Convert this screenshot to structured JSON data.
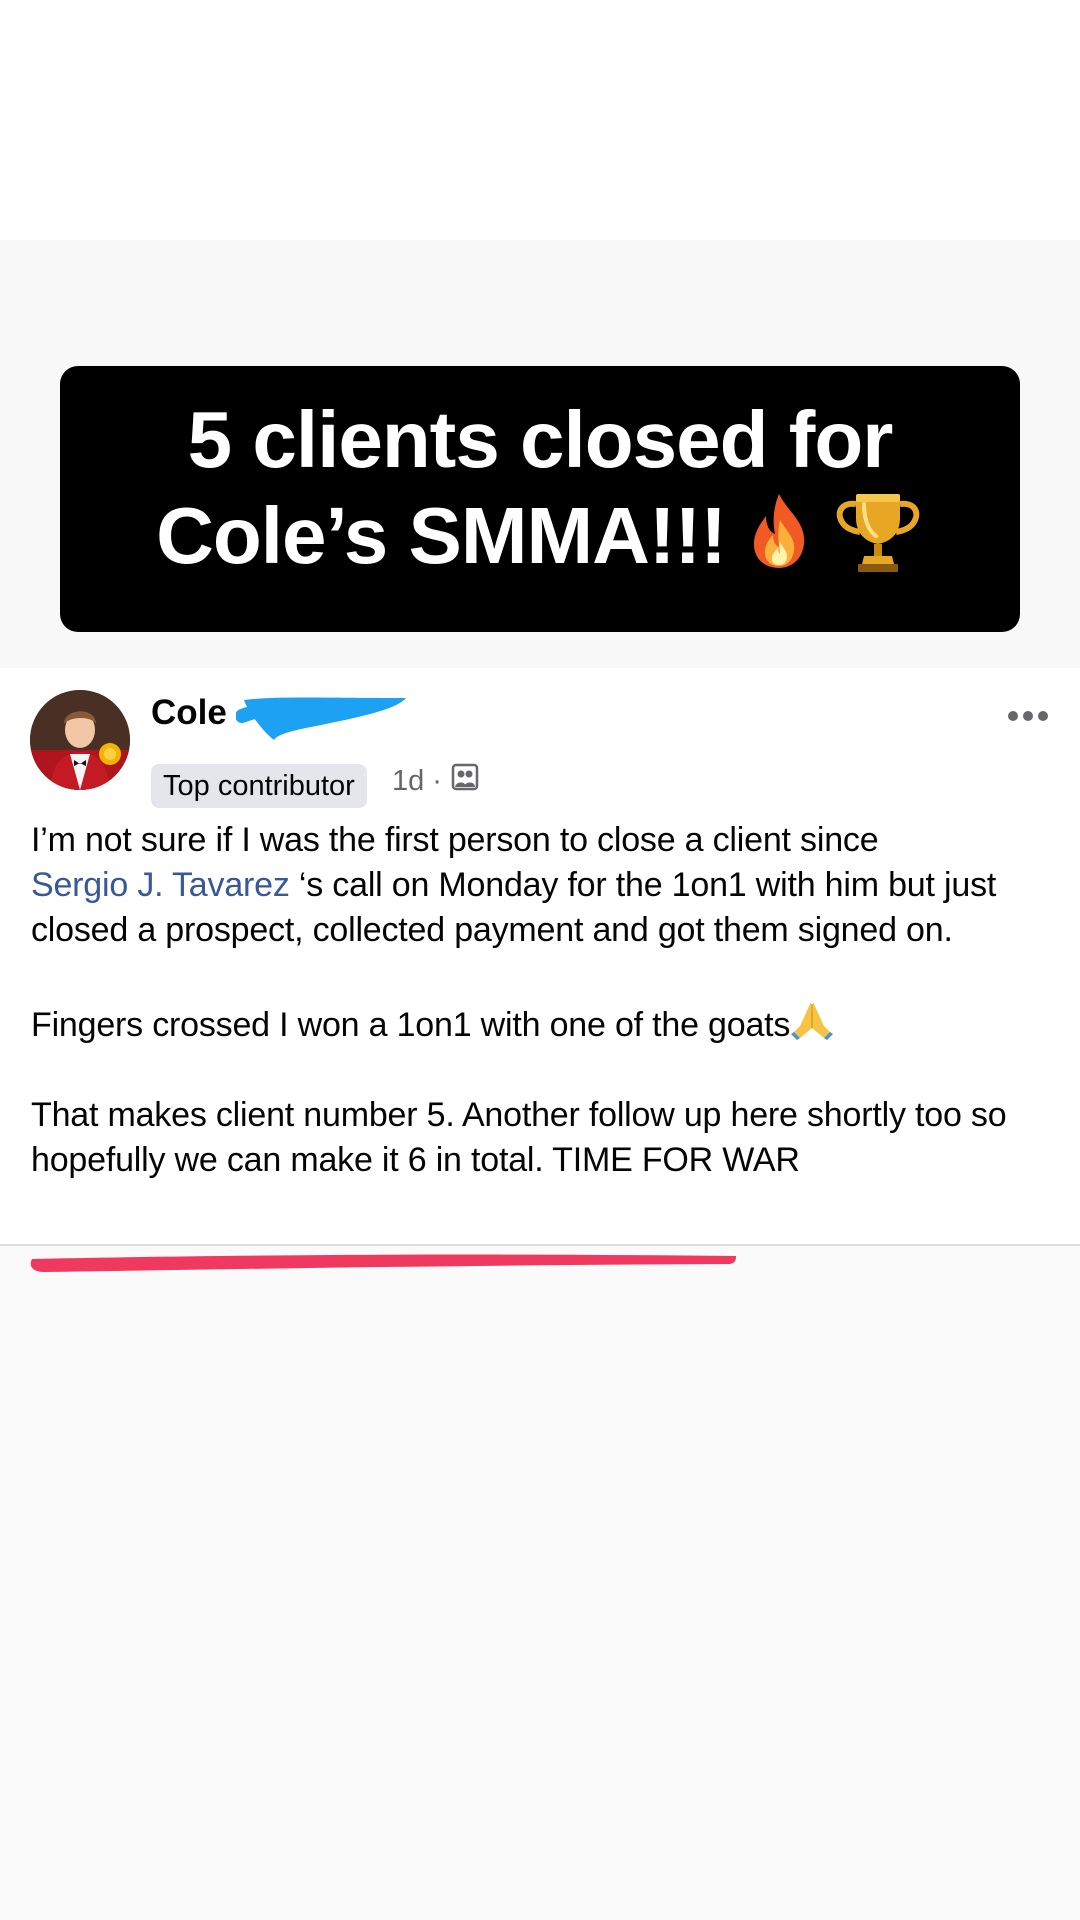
{
  "banner": {
    "line1": "5 clients closed for",
    "line2": "Cole’s SMMA!!!",
    "emojis": [
      "fire-icon",
      "trophy-icon"
    ]
  },
  "post": {
    "author_name": "Cole",
    "author_redacted": true,
    "badge": "Top contributor",
    "time": "1d",
    "separator": "·",
    "privacy_icon": "group-icon",
    "paragraph1_before": "I’m not sure if I was the first person to close a client since",
    "mention": "Sergio J. Tavarez",
    "paragraph1_after": "‘s call on Monday for the 1on1 with him but just closed a prospect, collected payment and got them signed on.",
    "paragraph2": "Fingers crossed I won a 1on1 with one of the goats",
    "paragraph2_emoji": "praying-hands-icon",
    "paragraph3": "That makes client number 5. Another follow up here shortly too so hopefully we can make it 6 in total. TIME FOR WAR"
  },
  "colors": {
    "banner_bg": "#000000",
    "banner_text": "#ffffff",
    "mention": "#385898",
    "redaction_blue": "#1da1f2",
    "highlight_underline": "#f0395f"
  }
}
